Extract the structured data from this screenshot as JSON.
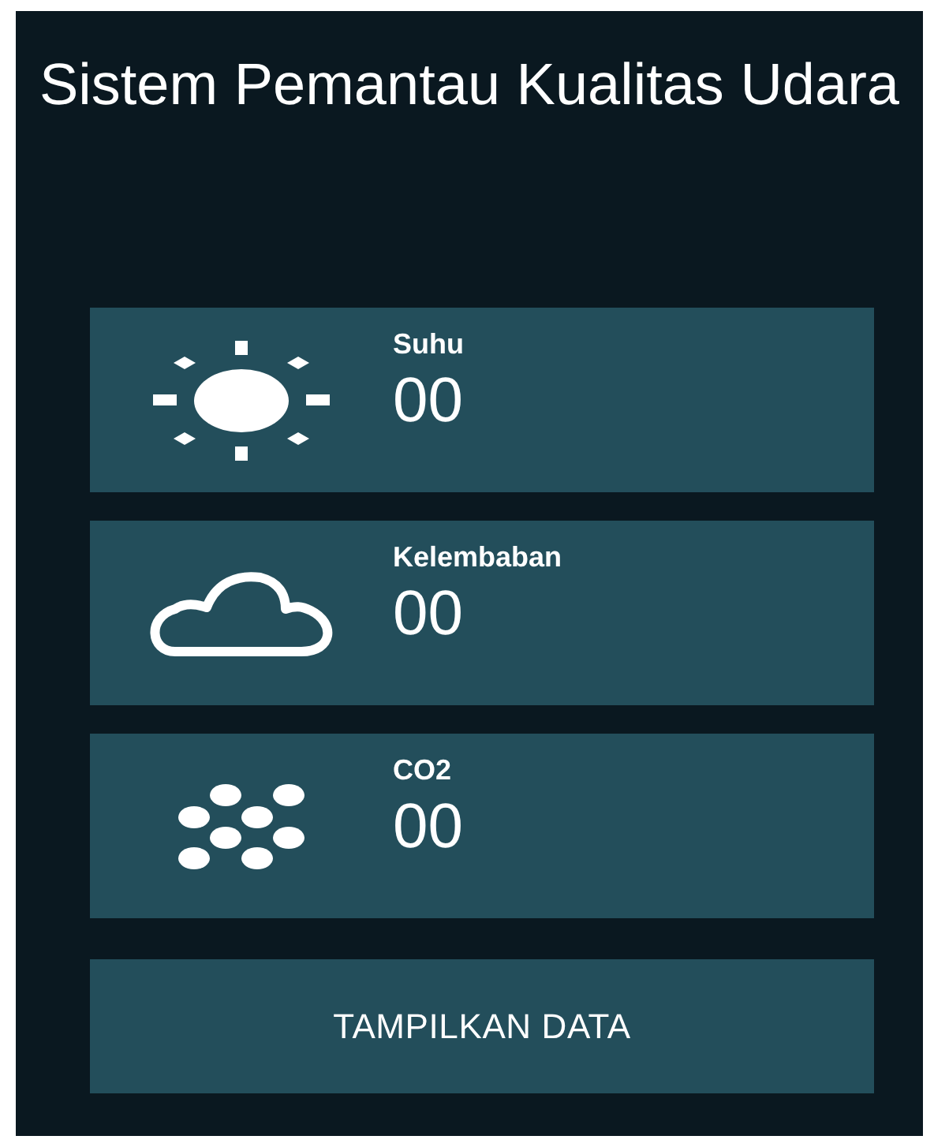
{
  "title": "Sistem Pemantau Kualitas Udara",
  "sensors": [
    {
      "kind": "sun",
      "label": "Suhu",
      "value": "00"
    },
    {
      "kind": "cloud",
      "label": "Kelembaban",
      "value": "00"
    },
    {
      "kind": "dots",
      "label": "CO2",
      "value": "00"
    }
  ],
  "button": "TAMPILKAN DATA"
}
